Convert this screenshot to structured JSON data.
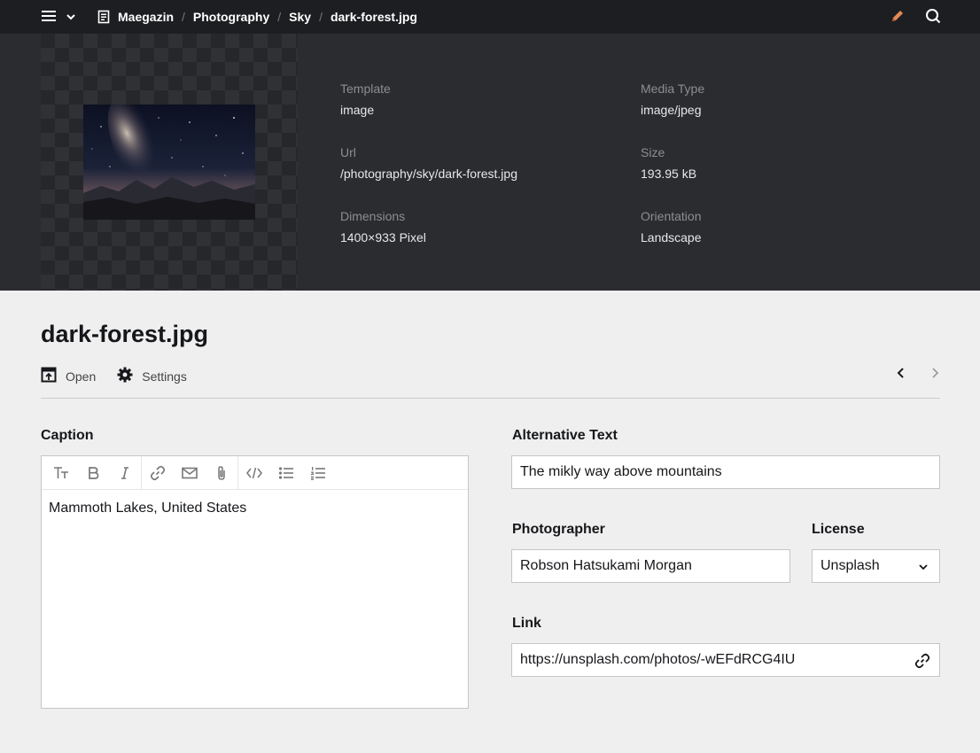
{
  "breadcrumb": [
    "Maegazin",
    "Photography",
    "Sky",
    "dark-forest.jpg"
  ],
  "meta": {
    "template": {
      "label": "Template",
      "value": "image"
    },
    "media_type": {
      "label": "Media Type",
      "value": "image/jpeg"
    },
    "url": {
      "label": "Url",
      "value": "/photography/sky/dark-forest.jpg"
    },
    "size": {
      "label": "Size",
      "value": "193.95 kB"
    },
    "dimensions": {
      "label": "Dimensions",
      "value": "1400×933 Pixel"
    },
    "orientation": {
      "label": "Orientation",
      "value": "Landscape"
    }
  },
  "page_title": "dark-forest.jpg",
  "actions": {
    "open": "Open",
    "settings": "Settings"
  },
  "fields": {
    "caption": {
      "label": "Caption",
      "value": "Mammoth Lakes, United States"
    },
    "alt_text": {
      "label": "Alternative Text",
      "value": "The mikly way above mountains"
    },
    "photographer": {
      "label": "Photographer",
      "value": "Robson Hatsukami Morgan"
    },
    "license": {
      "label": "License",
      "value": "Unsplash"
    },
    "link": {
      "label": "Link",
      "value": "https://unsplash.com/photos/-wEFdRCG4IU"
    }
  },
  "colors": {
    "topbar": "#1d1e21",
    "header_panel": "#2b2c30",
    "page_bg": "#efefef",
    "edit_icon": "#e38b56"
  },
  "icons": [
    "menu-icon",
    "chevron-down-icon",
    "page-icon",
    "pencil-icon",
    "search-icon",
    "open-icon",
    "gear-icon",
    "chevron-left-icon",
    "chevron-right-icon",
    "title-icon",
    "bold-icon",
    "italic-icon",
    "link-icon",
    "email-icon",
    "attachment-icon",
    "code-icon",
    "bullet-list-icon",
    "ordered-list-icon"
  ]
}
